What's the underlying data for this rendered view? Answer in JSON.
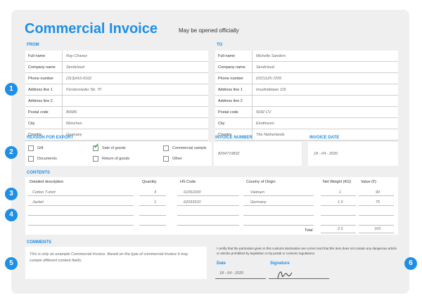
{
  "header": {
    "title": "Commercial Invoice",
    "subtitle": "May be opened officially"
  },
  "from": {
    "label": "FROM",
    "rows": [
      {
        "label": "Full name",
        "value": "Ray Chavez"
      },
      {
        "label": "Company name",
        "value": "Sendcloud"
      },
      {
        "label": "Phone number",
        "value": "(313)416-0162"
      },
      {
        "label": "Address line 1",
        "value": "Fürstenrieder Str. 70"
      },
      {
        "label": "Address line 2",
        "value": ""
      },
      {
        "label": "Postal code",
        "value": "80686"
      },
      {
        "label": "City",
        "value": "München"
      },
      {
        "label": "Country",
        "value": "Germany"
      }
    ]
  },
  "to": {
    "label": "TO",
    "rows": [
      {
        "label": "Full name",
        "value": "Michelle Sanders"
      },
      {
        "label": "Company name",
        "value": "Sendcloud"
      },
      {
        "label": "Phone number",
        "value": "(037)125-7205"
      },
      {
        "label": "Address line 1",
        "value": "Insulindelaan 115"
      },
      {
        "label": "Address line 2",
        "value": ""
      },
      {
        "label": "Postal code",
        "value": "5642 CV"
      },
      {
        "label": "City",
        "value": "Eindhoven"
      },
      {
        "label": "Country",
        "value": "The Netherlands"
      }
    ]
  },
  "export": {
    "label": "REASON FOR EXPORT",
    "options": [
      {
        "label": "Gift",
        "checked": false
      },
      {
        "label": "Documents",
        "checked": false
      },
      {
        "label": "Sale of goods",
        "checked": true
      },
      {
        "label": "Return of goods",
        "checked": false
      },
      {
        "label": "Commercial sample",
        "checked": false
      },
      {
        "label": "Other",
        "checked": false
      }
    ]
  },
  "invoice_number": {
    "label": "INVOICE NUMBER",
    "value": "8294719832"
  },
  "invoice_date": {
    "label": "INVOICE DATE",
    "value": "18 - 04 - 2020"
  },
  "contents": {
    "label": "CONTENTS",
    "headers": [
      "Detailed description",
      "Quantity",
      "HS Code",
      "Country of Origin",
      "Net Weight (KG)",
      "Value (€)"
    ],
    "rows": [
      {
        "description": "Cotton T-shirt",
        "quantity": "3",
        "hs_code": "61051000",
        "origin": "Vietnam",
        "weight": "1",
        "value": "90"
      },
      {
        "description": "Jacket",
        "quantity": "1",
        "hs_code": "62033310",
        "origin": "Germany",
        "weight": "1.5",
        "value": "75"
      }
    ],
    "total_label": "Total",
    "total_weight": "2.5",
    "total_value": "165"
  },
  "comments": {
    "label": "COMMENTS",
    "text": "This is only an example Commercial Invoice. Based on the type of commercial invoice it may contain different content fields."
  },
  "declaration": {
    "text": "I certify that the particulars given in this customs declaration are correct and that this item does not contain any dangerous article or articles prohibited by legislation or by postal or customs regulations.",
    "date_label": "Date",
    "date_value": "18 - 04 - 2020",
    "signature_label": "Signature"
  },
  "badges": [
    "1",
    "2",
    "3",
    "4",
    "5",
    "6"
  ],
  "colors": {
    "accent": "#1e8fe6",
    "check": "#3aa64c",
    "background": "#efefef"
  }
}
